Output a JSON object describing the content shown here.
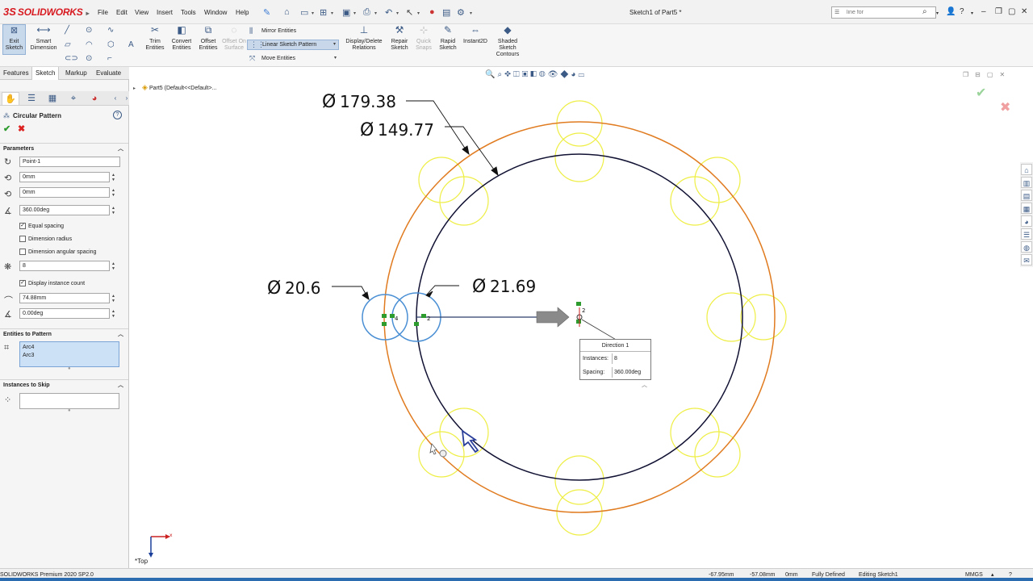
{
  "app": {
    "logo_prefix": "3S",
    "logo_text": "SOLIDWORKS",
    "title": "Sketch1 of Part5 *"
  },
  "menu": [
    "File",
    "Edit",
    "View",
    "Insert",
    "Tools",
    "Window",
    "Help"
  ],
  "search": {
    "value": "line for"
  },
  "ribbon": {
    "exit_sketch": "Exit Sketch",
    "smart_dimension": "Smart Dimension",
    "trim_entities": "Trim Entities",
    "convert_entities": "Convert Entities",
    "offset_entities": "Offset Entities",
    "offset_on_surface": "Offset On Surface",
    "mirror_entities": "Mirror Entities",
    "linear_sketch_pattern": "Linear Sketch Pattern",
    "move_entities": "Move Entities",
    "display_delete_relations": "Display/Delete Relations",
    "repair_sketch": "Repair Sketch",
    "quick_snaps": "Quick Snaps",
    "rapid_sketch": "Rapid Sketch",
    "instant2d": "Instant2D",
    "shaded_sketch_contours": "Shaded Sketch Contours"
  },
  "command_tabs": [
    "Features",
    "Sketch",
    "Markup",
    "Evaluate"
  ],
  "property_manager": {
    "title": "Circular Pattern",
    "groups": {
      "parameters": "Parameters",
      "entities": "Entities to Pattern",
      "skip": "Instances to Skip"
    },
    "center_point": "Point-1",
    "center_x": "0mm",
    "center_y": "0mm",
    "angle": "360.00deg",
    "equal_spacing": "Equal spacing",
    "dimension_radius": "Dimension radius",
    "dimension_angular_spacing": "Dimension angular spacing",
    "instances": "8",
    "display_instance_count": "Display instance count",
    "radius": "74.88mm",
    "arc_angle": "0.00deg",
    "entities": [
      "Arc4",
      "Arc3"
    ]
  },
  "feature_tree": {
    "item": "Part5  (Default<<Default>..."
  },
  "dimensions": {
    "d1": "179.38",
    "d2": "149.77",
    "d3": "20.6",
    "d4": "21.69"
  },
  "direction_popup": {
    "title": "Direction 1",
    "instances_label": "Instances:",
    "instances_value": "8",
    "spacing_label": "Spacing:",
    "spacing_value": "360.00deg"
  },
  "view": {
    "orientation": "*Top"
  },
  "status": {
    "version": "SOLIDWORKS Premium 2020 SP2.0",
    "x": "-67.95mm",
    "y": "-57.08mm",
    "z": "0mm",
    "state": "Fully Defined",
    "editing": "Editing Sketch1",
    "units": "MMGS"
  },
  "colors": {
    "outer_circle": "#e07b20",
    "pattern_circle": "#111133",
    "preview_circle": "#eeee44",
    "selected_circle": "#4a8fd4",
    "accent": "#3b5a85"
  }
}
